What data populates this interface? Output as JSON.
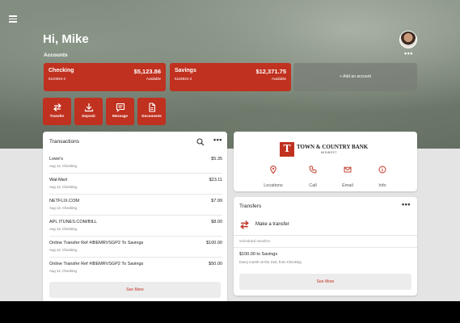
{
  "header": {
    "greeting": "Hi, Mike",
    "accounts_label": "Accounts",
    "menu_icon": "hamburger-icon",
    "more_icon": "more-horizontal-icon"
  },
  "accounts": [
    {
      "name": "Checking",
      "number": "6110834-2",
      "balance": "$5,123.86",
      "balance_label": "Available"
    },
    {
      "name": "Savings",
      "number": "5118834-3",
      "balance": "$12,371.75",
      "balance_label": "Available"
    }
  ],
  "add_account_label": "+ Add an account",
  "actions": [
    {
      "label": "Transfer",
      "icon": "swap-arrows-icon"
    },
    {
      "label": "Deposit",
      "icon": "download-tray-icon"
    },
    {
      "label": "Message",
      "icon": "chat-bubble-icon"
    },
    {
      "label": "Documents",
      "icon": "document-icon"
    }
  ],
  "transactions": {
    "title": "Transactions",
    "items": [
      {
        "merchant": "Lowe's",
        "date": "Aug 14, Checking",
        "amount": "$5.35"
      },
      {
        "merchant": "Wal-Mart",
        "date": "Aug 14, Checking",
        "amount": "$23.11"
      },
      {
        "merchant": "NETFLIX.COM",
        "date": "Aug 13, Checking",
        "amount": "$7.99"
      },
      {
        "merchant": "APL ITUNES.COM/BILL",
        "date": "Aug 13, Checking",
        "amount": "$8.00"
      },
      {
        "merchant": "Online Transfer Ref #IBEMRVSGP2 To Savings",
        "date": "Aug 12, Checking",
        "amount": "$100.00"
      },
      {
        "merchant": "Online Transfer Ref #IBEMRVSGP2 To Savings",
        "date": "Aug 12, Checking",
        "amount": "$50.00"
      }
    ],
    "see_more": "See More"
  },
  "bank": {
    "name": "TOWN & COUNTRY BANK",
    "subname": "MIDWEST",
    "logo_letter": "T",
    "links": [
      {
        "label": "Locations",
        "icon": "location-pin-icon"
      },
      {
        "label": "Call",
        "icon": "phone-icon"
      },
      {
        "label": "Email",
        "icon": "envelope-icon"
      },
      {
        "label": "Info",
        "icon": "info-icon"
      }
    ]
  },
  "transfers": {
    "title": "Transfers",
    "make_transfer": "Make a transfer",
    "scheduled_label": "Scheduled transfers",
    "scheduled": [
      {
        "amount_to": "$100.00 to Savings",
        "description": "Every month on the 21st, from Checking"
      }
    ],
    "see_more": "See More"
  },
  "colors": {
    "accent": "#c0311f",
    "background": "#e4e4e4"
  }
}
